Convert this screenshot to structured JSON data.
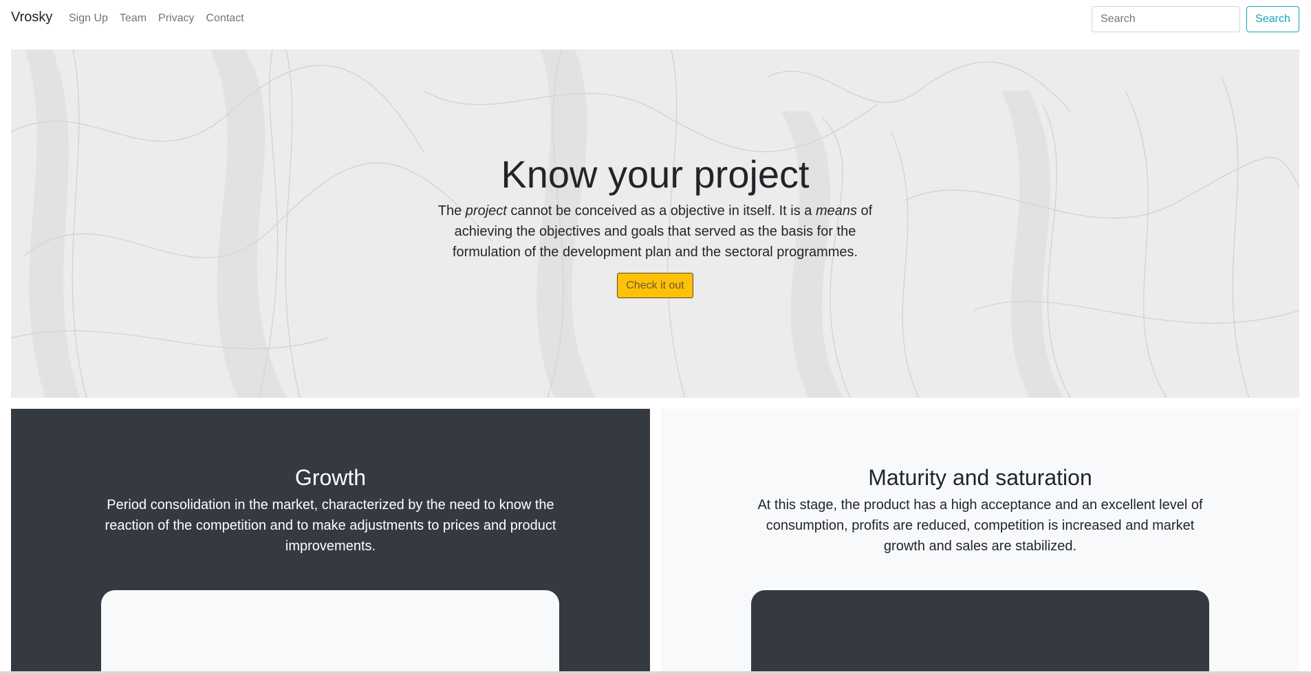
{
  "navbar": {
    "brand": "Vrosky",
    "links": [
      "Sign Up",
      "Team",
      "Privacy",
      "Contact"
    ],
    "search_placeholder": "Search",
    "search_button": "Search"
  },
  "hero": {
    "title": "Know your project",
    "text_parts": {
      "p1": "The ",
      "em1": "project",
      "p2": " cannot be conceived as a objective in itself. It is a ",
      "em2": "means",
      "p3": " of achieving the objectives and goals that served as the basis for the formulation of the development plan and the sectoral programmes."
    },
    "button": "Check it out"
  },
  "panels": [
    {
      "title": "Growth",
      "text": "Period consolidation in the market, characterized by the need to know the reaction of the competition and to make adjustments to prices and product improvements."
    },
    {
      "title": "Maturity and saturation",
      "text": "At this stage, the product has a high acceptance and an excellent level of consumption, profits are reduced, competition is increased and market growth and sales are stabilized."
    }
  ],
  "colors": {
    "dark": "#343a40",
    "light": "#f8f9fa",
    "accent": "#ffc107",
    "info": "#17a2b8"
  }
}
